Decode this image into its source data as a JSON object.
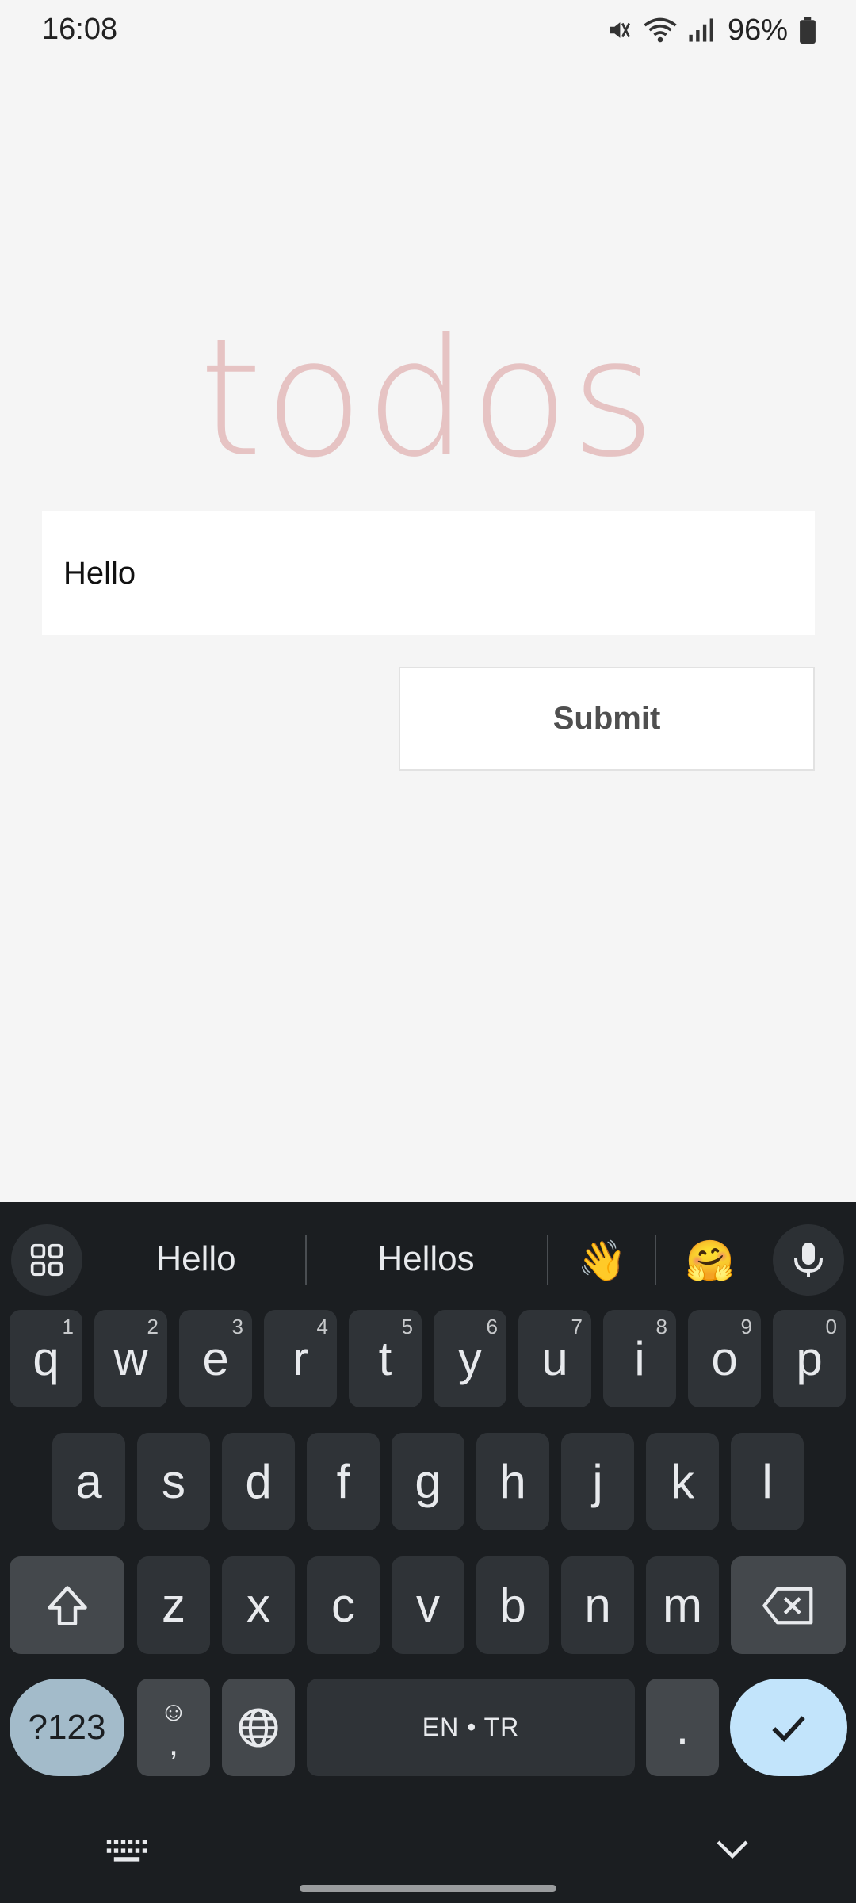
{
  "status_bar": {
    "time": "16:08",
    "battery": "96%",
    "icons": [
      "mute-icon",
      "wifi-icon",
      "signal-icon",
      "battery-icon"
    ]
  },
  "app": {
    "title": "todos",
    "input_value": "Hello",
    "submit_label": "Submit"
  },
  "keyboard": {
    "suggestions": [
      "Hello",
      "Hellos"
    ],
    "emoji_suggestions": [
      "👋",
      "🤗"
    ],
    "row1": [
      {
        "key": "q",
        "hint": "1"
      },
      {
        "key": "w",
        "hint": "2"
      },
      {
        "key": "e",
        "hint": "3"
      },
      {
        "key": "r",
        "hint": "4"
      },
      {
        "key": "t",
        "hint": "5"
      },
      {
        "key": "y",
        "hint": "6"
      },
      {
        "key": "u",
        "hint": "7"
      },
      {
        "key": "i",
        "hint": "8"
      },
      {
        "key": "o",
        "hint": "9"
      },
      {
        "key": "p",
        "hint": "0"
      }
    ],
    "row2": [
      "a",
      "s",
      "d",
      "f",
      "g",
      "h",
      "j",
      "k",
      "l"
    ],
    "row3": [
      "z",
      "x",
      "c",
      "v",
      "b",
      "n",
      "m"
    ],
    "symbols_label": "?123",
    "comma_emoji": "☺",
    "comma": ",",
    "space_label": "EN • TR",
    "period": "."
  },
  "colors": {
    "title": "#e6c3c3",
    "keyboard_bg": "#1b1e21",
    "key_bg": "#2f3337",
    "enter_bg": "#c2e4fb",
    "symbols_bg": "#a3bbca"
  }
}
